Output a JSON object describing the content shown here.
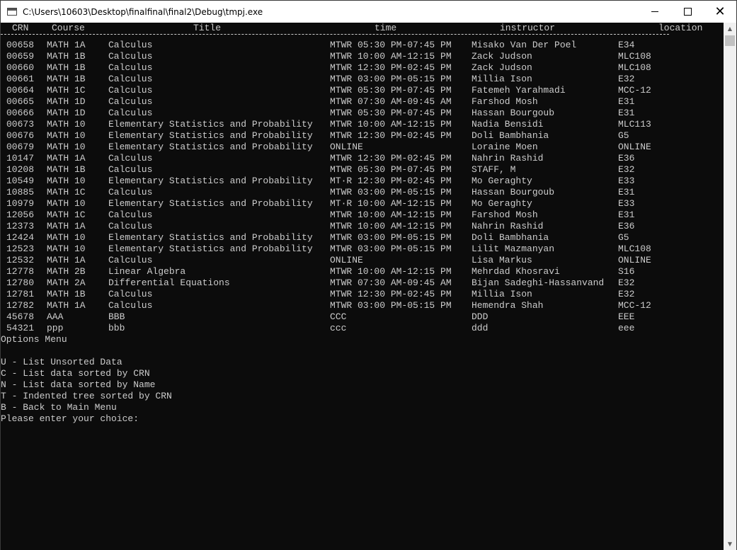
{
  "window": {
    "title": "C:\\Users\\10603\\Desktop\\finalfinal\\final2\\Debug\\tmpj.exe",
    "close_glyph": "✕"
  },
  "table": {
    "headers": [
      "CRN",
      "Course",
      "Title",
      "time",
      "instructor",
      "location"
    ],
    "rows": [
      [
        "00658",
        "MATH 1A",
        "Calculus",
        "MTWR 05:30 PM-07:45 PM",
        "Misako Van Der Poel",
        "E34"
      ],
      [
        "00659",
        "MATH 1B",
        "Calculus",
        "MTWR 10:00 AM-12:15 PM",
        "Zack Judson",
        "MLC108"
      ],
      [
        "00660",
        "MATH 1B",
        "Calculus",
        "MTWR 12:30 PM-02:45 PM",
        "Zack Judson",
        "MLC108"
      ],
      [
        "00661",
        "MATH 1B",
        "Calculus",
        "MTWR 03:00 PM-05:15 PM",
        "Millia Ison",
        "E32"
      ],
      [
        "00664",
        "MATH 1C",
        "Calculus",
        "MTWR 05:30 PM-07:45 PM",
        "Fatemeh Yarahmadi",
        "MCC-12"
      ],
      [
        "00665",
        "MATH 1D",
        "Calculus",
        "MTWR 07:30 AM-09:45 AM",
        "Farshod Mosh",
        "E31"
      ],
      [
        "00666",
        "MATH 1D",
        "Calculus",
        "MTWR 05:30 PM-07:45 PM",
        "Hassan Bourgoub",
        "E31"
      ],
      [
        "00673",
        "MATH 10",
        "Elementary Statistics and Probability",
        "MTWR 10:00 AM-12:15 PM",
        "Nadia Bensidi",
        "MLC113"
      ],
      [
        "00676",
        "MATH 10",
        "Elementary Statistics and Probability",
        "MTWR 12:30 PM-02:45 PM",
        "Doli Bambhania",
        "G5"
      ],
      [
        "00679",
        "MATH 10",
        "Elementary Statistics and Probability",
        "ONLINE",
        "Loraine Moen",
        "ONLINE"
      ],
      [
        "10147",
        "MATH 1A",
        "Calculus",
        "MTWR 12:30 PM-02:45 PM",
        "Nahrin Rashid",
        "E36"
      ],
      [
        "10208",
        "MATH 1B",
        "Calculus",
        "MTWR 05:30 PM-07:45 PM",
        "STAFF, M",
        "E32"
      ],
      [
        "10549",
        "MATH 10",
        "Elementary Statistics and Probability",
        "MT·R 12:30 PM-02:45 PM",
        "Mo Geraghty",
        "E33"
      ],
      [
        "10885",
        "MATH 1C",
        "Calculus",
        "MTWR 03:00 PM-05:15 PM",
        "Hassan Bourgoub",
        "E31"
      ],
      [
        "10979",
        "MATH 10",
        "Elementary Statistics and Probability",
        "MT·R 10:00 AM-12:15 PM",
        "Mo Geraghty",
        "E33"
      ],
      [
        "12056",
        "MATH 1C",
        "Calculus",
        "MTWR 10:00 AM-12:15 PM",
        "Farshod Mosh",
        "E31"
      ],
      [
        "12373",
        "MATH 1A",
        "Calculus",
        "MTWR 10:00 AM-12:15 PM",
        "Nahrin Rashid",
        "E36"
      ],
      [
        "12424",
        "MATH 10",
        "Elementary Statistics and Probability",
        "MTWR 03:00 PM-05:15 PM",
        "Doli Bambhania",
        "G5"
      ],
      [
        "12523",
        "MATH 10",
        "Elementary Statistics and Probability",
        "MTWR 03:00 PM-05:15 PM",
        "Lilit Mazmanyan",
        "MLC108"
      ],
      [
        "12532",
        "MATH 1A",
        "Calculus",
        "ONLINE",
        "Lisa Markus",
        "ONLINE"
      ],
      [
        "12778",
        "MATH 2B",
        "Linear Algebra",
        "MTWR 10:00 AM-12:15 PM",
        "Mehrdad Khosravi",
        "S16"
      ],
      [
        "12780",
        "MATH 2A",
        "Differential Equations",
        "MTWR 07:30 AM-09:45 AM",
        "Bijan Sadeghi-Hassanvand",
        "E32"
      ],
      [
        "12781",
        "MATH 1B",
        "Calculus",
        "MTWR 12:30 PM-02:45 PM",
        "Millia Ison",
        "E32"
      ],
      [
        "12782",
        "MATH 1A",
        "Calculus",
        "MTWR 03:00 PM-05:15 PM",
        "Hemendra Shah",
        "MCC-12"
      ],
      [
        "45678",
        "AAA",
        "BBB",
        "CCC",
        "DDD",
        "EEE"
      ],
      [
        "54321",
        "ppp",
        "bbb",
        "ccc",
        "ddd",
        "eee"
      ]
    ]
  },
  "menu": {
    "title": "Options Menu",
    "options": [
      "U - List Unsorted Data",
      "C - List data sorted by CRN",
      "N - List data sorted by Name",
      "T - Indented tree sorted by CRN",
      "B - Back to Main Menu"
    ],
    "prompt": "Please enter your choice:"
  }
}
